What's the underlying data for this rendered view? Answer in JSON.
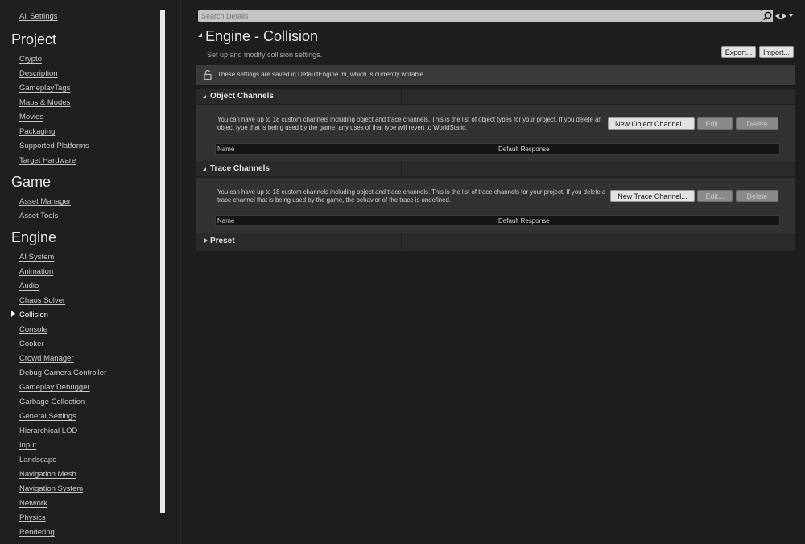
{
  "sidebar": {
    "all_settings": "All Settings",
    "categories": [
      {
        "name": "Project",
        "items": [
          "Crypto",
          "Description",
          "GameplayTags",
          "Maps & Modes",
          "Movies",
          "Packaging",
          "Supported Platforms",
          "Target Hardware"
        ]
      },
      {
        "name": "Game",
        "items": [
          "Asset Manager",
          "Asset Tools"
        ]
      },
      {
        "name": "Engine",
        "items": [
          "AI System",
          "Animation",
          "Audio",
          "Chaos Solver",
          "Collision",
          "Console",
          "Cooker",
          "Crowd Manager",
          "Debug Camera Controller",
          "Gameplay Debugger",
          "Garbage Collection",
          "General Settings",
          "Hierarchical LOD",
          "Input",
          "Landscape",
          "Navigation Mesh",
          "Navigation System",
          "Network",
          "Physics",
          "Rendering"
        ]
      }
    ],
    "active_item": "Collision"
  },
  "search": {
    "placeholder": "Search Details",
    "value": ""
  },
  "page": {
    "title": "Engine - Collision",
    "subtitle": "Set up and modify collision settings.",
    "export_label": "Export...",
    "import_label": "Import..."
  },
  "notice": {
    "text": "These settings are saved in DefaultEngine.ini, which is currently writable."
  },
  "object_channels": {
    "title": "Object Channels",
    "description": "You can have up to 18 custom channels including object and trace channels. This is the list of object types for your project. If you delete an object type that is being used by the game, any uses of that type will revert to WorldStatic.",
    "new_label": "New Object Channel...",
    "edit_label": "Edit...",
    "delete_label": "Delete",
    "col_name": "Name",
    "col_response": "Default Response"
  },
  "trace_channels": {
    "title": "Trace Channels",
    "description": "You can have up to 18 custom channels including object and trace channels. This is the list of trace channels for your project. If you delete a trace channel that is being used by the game, the behavior of the trace is undefined.",
    "new_label": "New Trace Channel...",
    "edit_label": "Edit...",
    "delete_label": "Delete",
    "col_name": "Name",
    "col_response": "Default Response"
  },
  "preset": {
    "title": "Preset"
  },
  "colors": {
    "background": "#1e1e21",
    "panel": "#323235",
    "header": "#2a2a2d",
    "button": "#e2e2e2",
    "button_disabled": "#8a8a8a"
  }
}
